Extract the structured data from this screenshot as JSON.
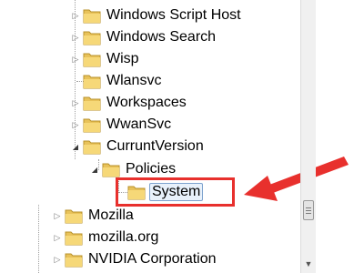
{
  "tree": {
    "items": [
      {
        "label": "Windows Script Host"
      },
      {
        "label": "Windows Search"
      },
      {
        "label": "Wisp"
      },
      {
        "label": "Wlansvc"
      },
      {
        "label": "Workspaces"
      },
      {
        "label": "WwanSvc"
      },
      {
        "label": "CurruntVersion"
      },
      {
        "label": "Policies"
      },
      {
        "label": "System"
      },
      {
        "label": "Mozilla"
      },
      {
        "label": "mozilla.org"
      },
      {
        "label": "NVIDIA Corporation"
      }
    ],
    "selected": "System"
  },
  "annotation": {
    "color": "#e8302d"
  },
  "icons": {
    "expand": "triangle-right",
    "collapse": "triangle-down",
    "folder": "folder-icon"
  }
}
